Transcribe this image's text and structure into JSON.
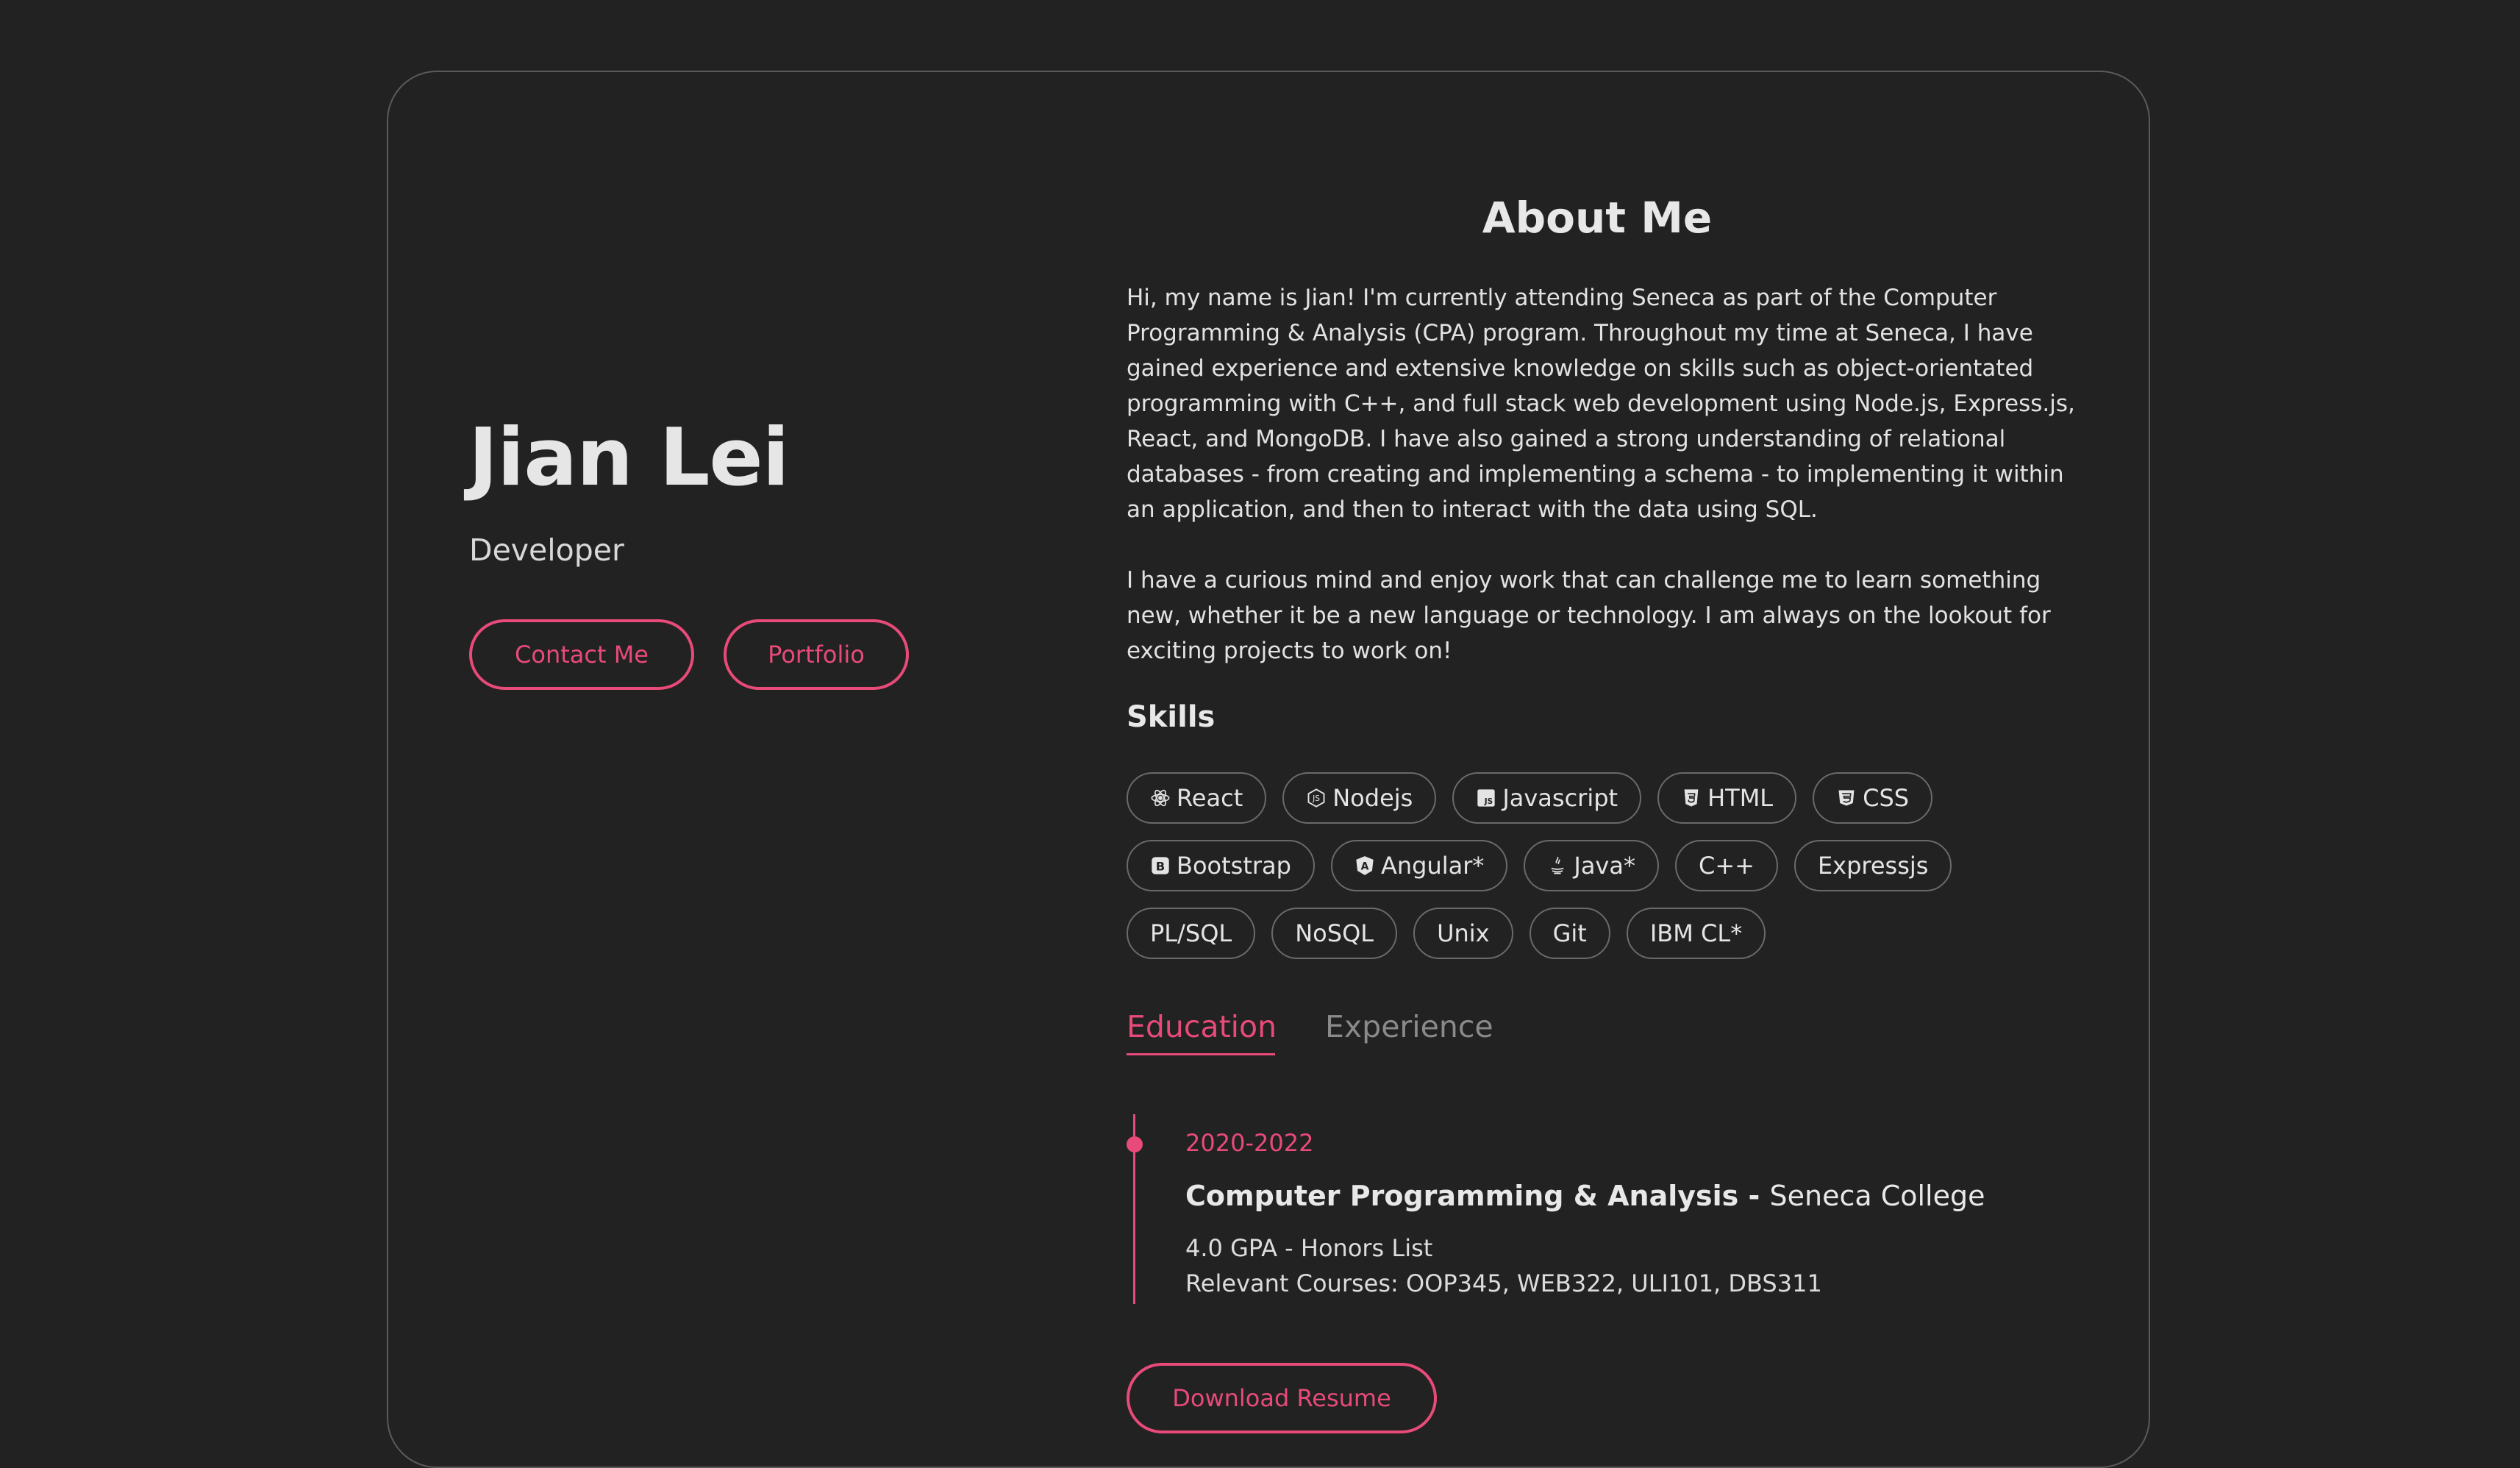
{
  "hero": {
    "name": "Jian Lei",
    "role": "Developer",
    "contact_label": "Contact Me",
    "portfolio_label": "Portfolio"
  },
  "about": {
    "title": "About Me",
    "paragraph1": "Hi, my name is Jian! I'm currently attending Seneca as part of the Computer Programming & Analysis (CPA) program. Throughout my time at Seneca, I have gained experience and extensive knowledge on skills such as object-orientated programming with C++, and full stack web development using Node.js, Express.js, React, and MongoDB. I have also gained a strong understanding of relational databases - from creating and implementing a schema - to implementing it within an application, and then to interact with the data using SQL.",
    "paragraph2": "I have a curious mind and enjoy work that can challenge me to learn something new, whether it be a new language or technology. I am always on the lookout for exciting projects to work on!"
  },
  "skills": {
    "title": "Skills",
    "items": [
      {
        "label": "React",
        "icon": "react-icon"
      },
      {
        "label": "Nodejs",
        "icon": "nodejs-icon"
      },
      {
        "label": "Javascript",
        "icon": "javascript-icon"
      },
      {
        "label": "HTML",
        "icon": "html-icon"
      },
      {
        "label": "CSS",
        "icon": "css-icon"
      },
      {
        "label": "Bootstrap",
        "icon": "bootstrap-icon"
      },
      {
        "label": "Angular*",
        "icon": "angular-icon"
      },
      {
        "label": "Java*",
        "icon": "java-icon"
      },
      {
        "label": "C++",
        "icon": ""
      },
      {
        "label": "Expressjs",
        "icon": ""
      },
      {
        "label": "PL/SQL",
        "icon": ""
      },
      {
        "label": "NoSQL",
        "icon": ""
      },
      {
        "label": "Unix",
        "icon": ""
      },
      {
        "label": "Git",
        "icon": ""
      },
      {
        "label": "IBM CL*",
        "icon": ""
      }
    ]
  },
  "tabs": {
    "education": "Education",
    "experience": "Experience"
  },
  "education": {
    "years": "2020-2022",
    "degree": "Computer Programming & Analysis - ",
    "school": "Seneca College",
    "gpa": "4.0 GPA - Honors List",
    "courses": "Relevant Courses: OOP345, WEB322, ULI101, DBS311"
  },
  "actions": {
    "download_resume": "Download Resume"
  },
  "colors": {
    "background": "#222222",
    "accent": "#e84a79",
    "card_border": "#5a5a5a",
    "muted_tab": "#8a8a8a"
  }
}
